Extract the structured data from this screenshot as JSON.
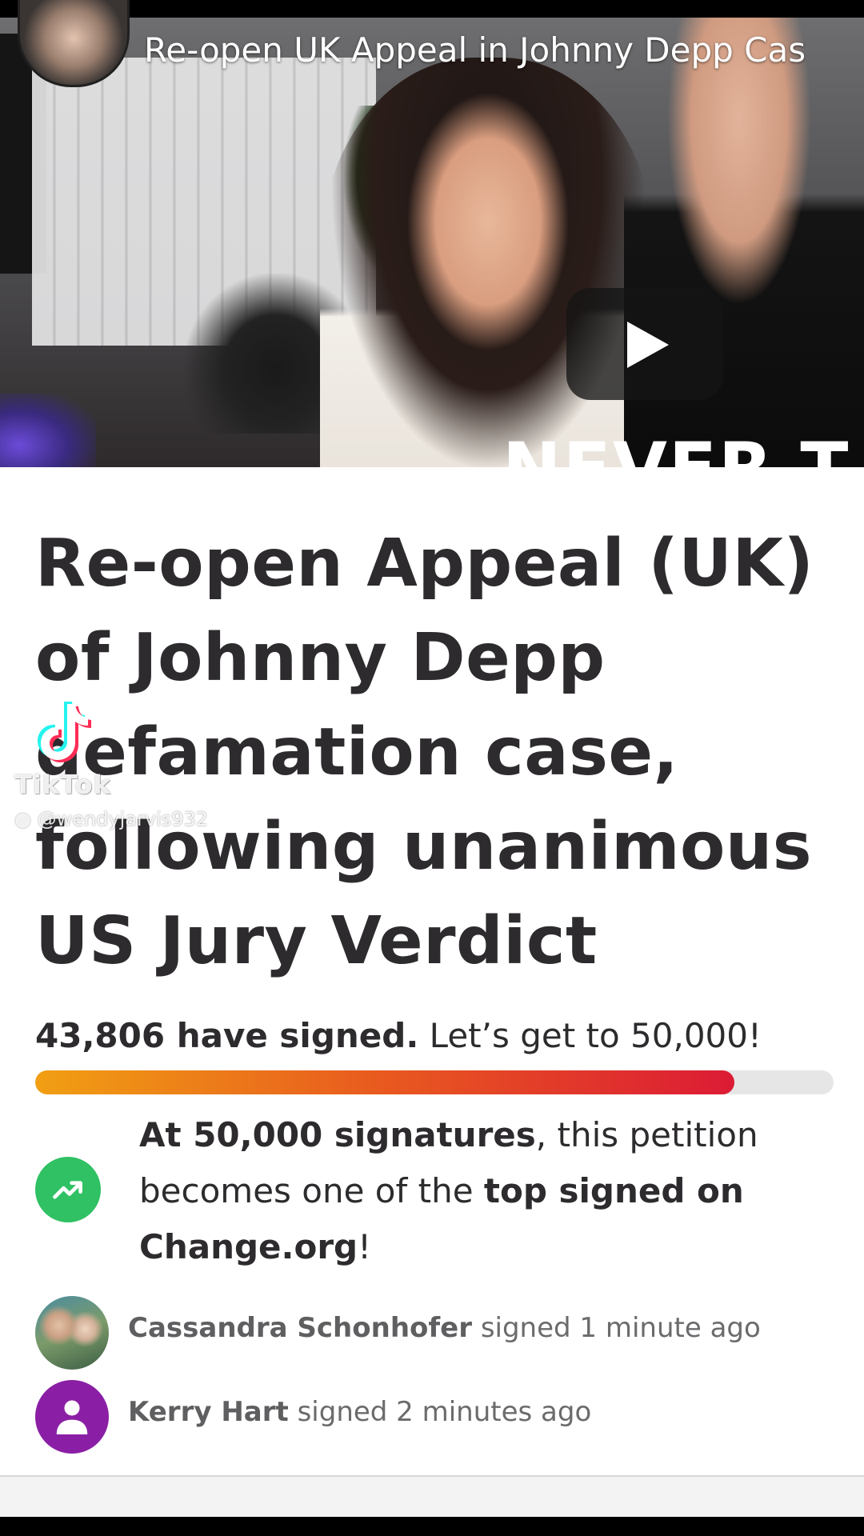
{
  "video": {
    "title": "Re-open UK Appeal in Johnny Depp Cas",
    "overlay_text": "NEVER T"
  },
  "petition": {
    "title": "Re-open Appeal (UK) of Johnny Depp defamation case, following unanimous US Jury Verdict",
    "signed_count": "43,806 have signed.",
    "goal_text": "Let’s get to 50,000!",
    "progress_fraction": 0.876,
    "milestone": {
      "part1_bold": "At 50,000 signatures",
      "part2": ", this petition becomes one of the ",
      "part3_bold": "top signed on Change.org",
      "part4": "!"
    }
  },
  "recent_signers": [
    {
      "name": "Cassandra Schonhofer",
      "action": "signed 1 minute ago",
      "avatar": "photo"
    },
    {
      "name": "Kerry Hart",
      "action": "signed 2 minutes ago",
      "avatar": "person-icon"
    }
  ],
  "watermark": {
    "brand": "TikTok",
    "handle": "@wendyjarvis932"
  },
  "colors": {
    "progress_start": "#f19f13",
    "progress_end": "#dc1b35",
    "milestone_icon_bg": "#2fc163",
    "generic_avatar_bg": "#8a1fa5",
    "title_text": "#2d2b2e"
  }
}
